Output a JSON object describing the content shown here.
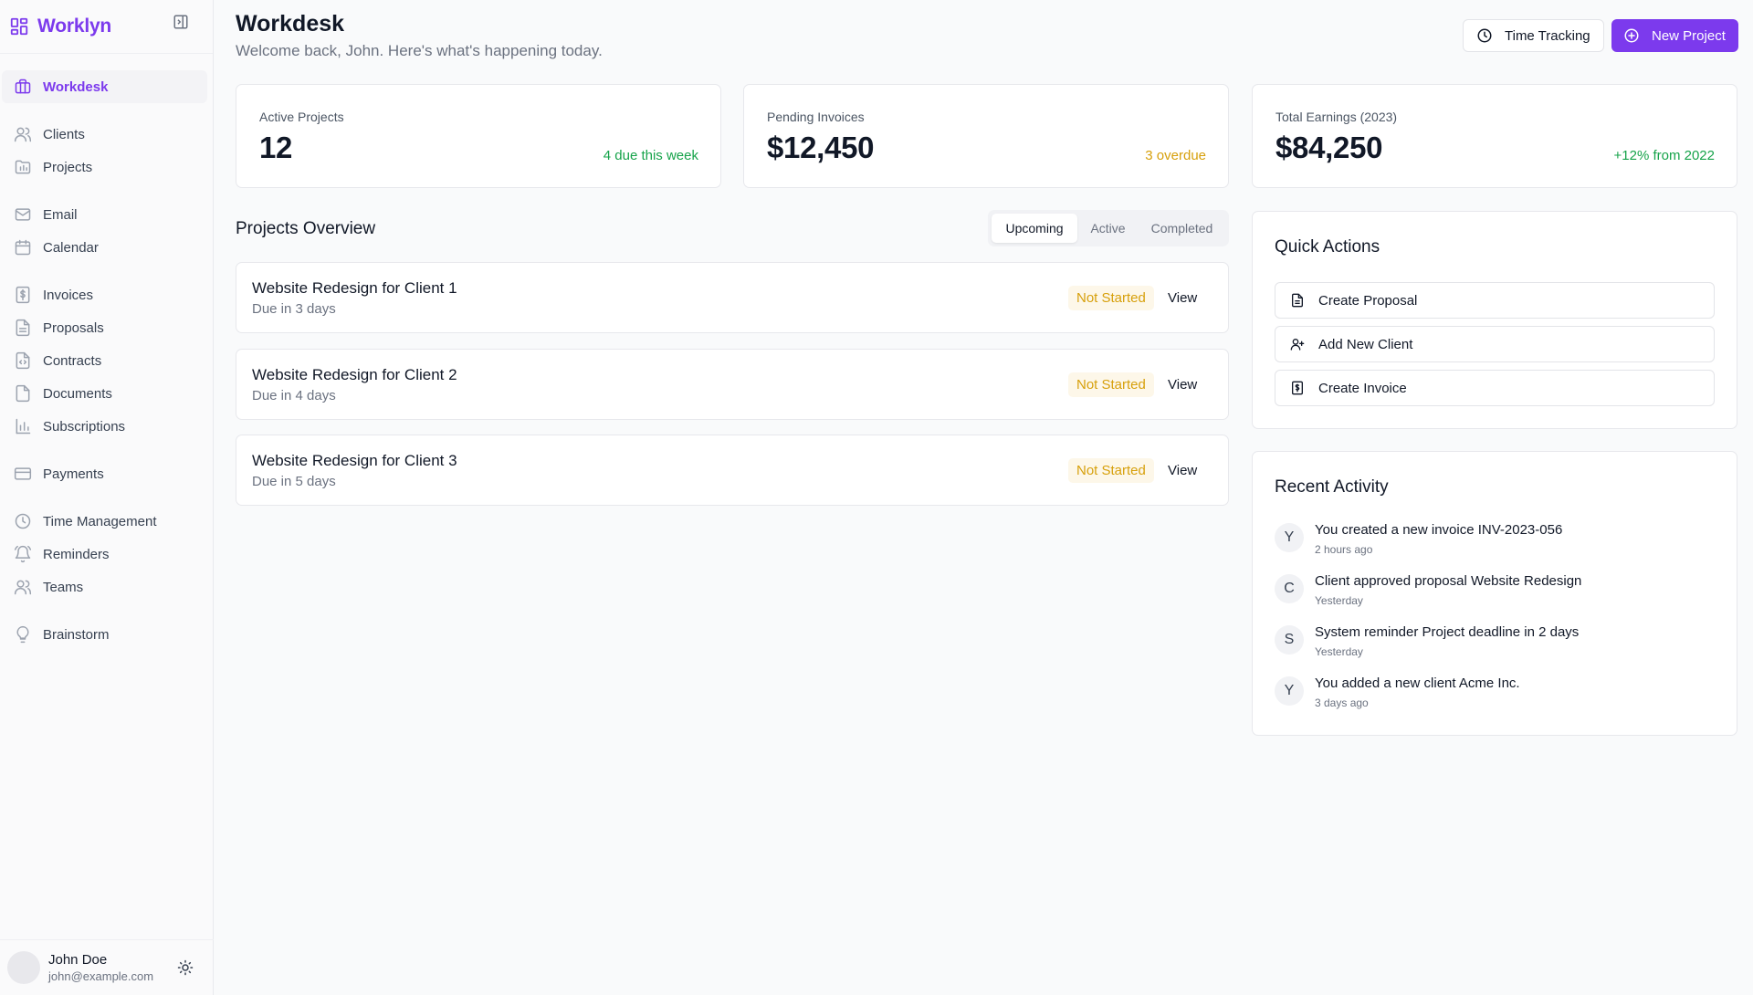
{
  "sidebar": {
    "brand": "Worklyn",
    "nav_groups": [
      [
        {
          "label": "Workdesk",
          "icon": "briefcase-icon",
          "active": true
        }
      ],
      [
        {
          "label": "Clients",
          "icon": "users-icon"
        },
        {
          "label": "Projects",
          "icon": "folder-chart-icon"
        }
      ],
      [
        {
          "label": "Email",
          "icon": "mail-icon"
        },
        {
          "label": "Calendar",
          "icon": "calendar-icon"
        }
      ],
      [
        {
          "label": "Invoices",
          "icon": "invoice-icon"
        },
        {
          "label": "Proposals",
          "icon": "file-text-icon"
        },
        {
          "label": "Contracts",
          "icon": "contract-icon"
        },
        {
          "label": "Documents",
          "icon": "file-icon"
        },
        {
          "label": "Subscriptions",
          "icon": "bar-chart-icon"
        }
      ],
      [
        {
          "label": "Payments",
          "icon": "credit-card-icon"
        }
      ],
      [
        {
          "label": "Time Management",
          "icon": "clock-icon"
        },
        {
          "label": "Reminders",
          "icon": "bell-icon"
        },
        {
          "label": "Teams",
          "icon": "users-icon"
        }
      ],
      [
        {
          "label": "Brainstorm",
          "icon": "lightbulb-icon"
        }
      ]
    ],
    "user": {
      "name": "John Doe",
      "email": "john@example.com"
    }
  },
  "header": {
    "title": "Workdesk",
    "subtitle": "Welcome back, John. Here's what's happening today.",
    "time_tracking_label": "Time Tracking",
    "new_project_label": "New Project"
  },
  "stats": [
    {
      "label": "Active Projects",
      "value": "12",
      "note": "4 due this week",
      "note_color": "#16a34a"
    },
    {
      "label": "Pending Invoices",
      "value": "$12,450",
      "note": "3 overdue",
      "note_color": "#d7a00c"
    },
    {
      "label": "Total Earnings (2023)",
      "value": "$84,250",
      "note": "+12% from 2022",
      "note_color": "#16a34a"
    }
  ],
  "projects_overview": {
    "title": "Projects Overview",
    "tabs": [
      "Upcoming",
      "Active",
      "Completed"
    ],
    "active_tab": 0,
    "projects": [
      {
        "name": "Website Redesign for Client 1",
        "due": "Due in 3 days",
        "status": "Not Started",
        "action": "View"
      },
      {
        "name": "Website Redesign for Client 2",
        "due": "Due in 4 days",
        "status": "Not Started",
        "action": "View"
      },
      {
        "name": "Website Redesign for Client 3",
        "due": "Due in 5 days",
        "status": "Not Started",
        "action": "View"
      }
    ]
  },
  "quick_actions": {
    "title": "Quick Actions",
    "items": [
      {
        "label": "Create Proposal",
        "icon": "file-text-icon"
      },
      {
        "label": "Add New Client",
        "icon": "user-plus-icon"
      },
      {
        "label": "Create Invoice",
        "icon": "invoice-icon"
      }
    ]
  },
  "recent_activity": {
    "title": "Recent Activity",
    "items": [
      {
        "initial": "Y",
        "text": "You created a new invoice INV-2023-056",
        "time": "2 hours ago"
      },
      {
        "initial": "C",
        "text": "Client approved proposal Website Redesign",
        "time": "Yesterday"
      },
      {
        "initial": "S",
        "text": "System reminder Project deadline in 2 days",
        "time": "Yesterday"
      },
      {
        "initial": "Y",
        "text": "You added a new client Acme Inc.",
        "time": "3 days ago"
      }
    ]
  },
  "colors": {
    "accent": "#7c3aed",
    "success": "#16a34a",
    "warning": "#d7a00c"
  }
}
